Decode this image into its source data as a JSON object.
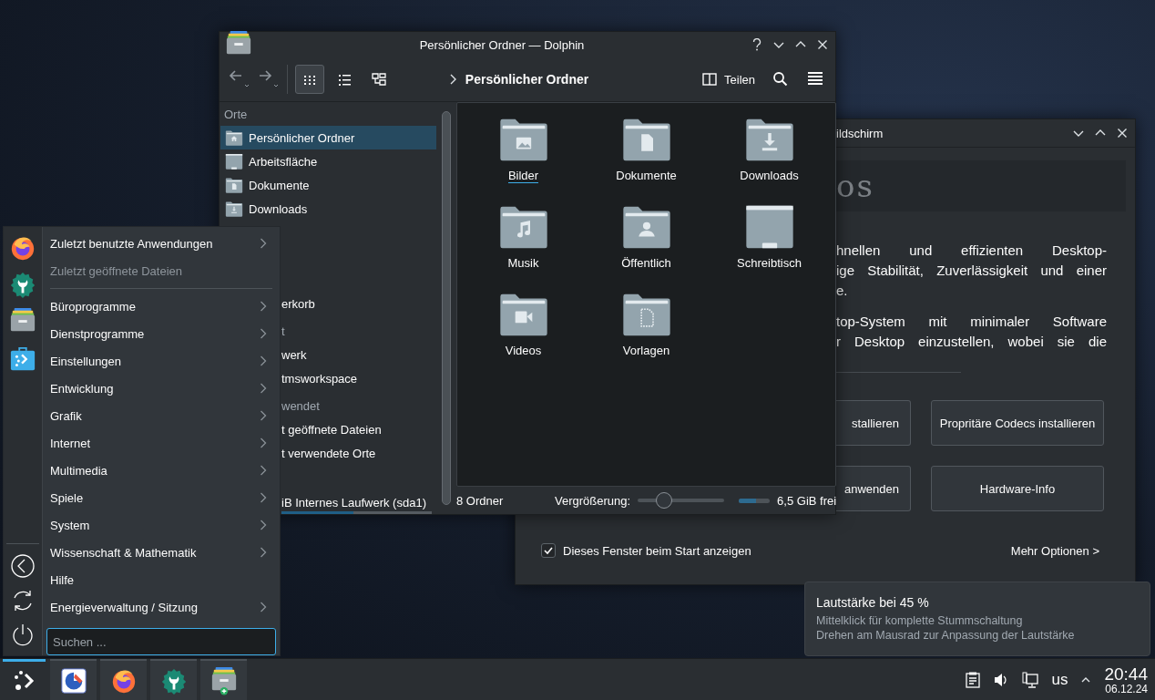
{
  "dolphin": {
    "title": "Persönlicher Ordner — Dolphin",
    "view_modes": [
      {
        "selected": true
      },
      {
        "selected": false
      },
      {
        "selected": false
      }
    ],
    "breadcrumb": "Persönlicher Ordner",
    "split_label": "Teilen",
    "sidebar": {
      "heading": "Orte",
      "items": [
        {
          "label": "Persönlicher Ordner",
          "selected": true
        },
        {
          "label": "Arbeitsfläche",
          "selected": false
        },
        {
          "label": "Dokumente",
          "selected": false
        },
        {
          "label": "Downloads",
          "selected": false
        }
      ],
      "covered_items": [
        {
          "kind": "item",
          "label": "erkorb"
        },
        {
          "kind": "heading",
          "label": "t"
        },
        {
          "kind": "item",
          "label": "werk"
        },
        {
          "kind": "item",
          "label": "tmsworkspace"
        },
        {
          "kind": "heading",
          "label": "wendet"
        },
        {
          "kind": "item",
          "label": "t geöffnete Dateien"
        },
        {
          "kind": "item",
          "label": "t verwendete Orte"
        },
        {
          "kind": "drive",
          "label": "iB Internes Laufwerk (sda1)",
          "level": 0.48
        }
      ]
    },
    "folders": [
      {
        "label": "Bilder",
        "kind": "image",
        "current": true
      },
      {
        "label": "Dokumente",
        "kind": "document",
        "current": false
      },
      {
        "label": "Downloads",
        "kind": "download",
        "current": false
      },
      {
        "label": "Musik",
        "kind": "music",
        "current": false
      },
      {
        "label": "Öffentlich",
        "kind": "user",
        "current": false
      },
      {
        "label": "Schreibtisch",
        "kind": "desktop",
        "current": false
      },
      {
        "label": "Videos",
        "kind": "video",
        "current": false
      },
      {
        "label": "Vorlagen",
        "kind": "template",
        "current": false
      }
    ],
    "status": {
      "count": "8 Ordner",
      "zoom_label": "Vergrößerung:",
      "zoom": {
        "level": 0.3
      },
      "free_space": {
        "level": 0.55
      },
      "free_label": "6,5 GiB frei"
    }
  },
  "welcome": {
    "title": "ildschirm",
    "logo": "os",
    "paragraphs": [
      [
        "hnellen und effizienten Desktop-",
        "ige Stabilität, Zuverlässigkeit und einer",
        "e."
      ],
      [
        "top-System mit minimaler Software",
        "r Desktop einzustellen, wobei sie die"
      ]
    ],
    "buttons": [
      "stallieren",
      "Propritäre Codecs installieren",
      "anwenden",
      "Hardware-Info"
    ],
    "show_on_start": {
      "label": "Dieses Fenster beim Start anzeigen",
      "checked": true
    },
    "more_link": "Mehr Optionen >"
  },
  "app_menu": {
    "items": [
      {
        "kind": "entry",
        "label": "Zuletzt benutzte Anwendungen",
        "submenu": true,
        "disabled": false
      },
      {
        "kind": "entry",
        "label": "Zuletzt geöffnete Dateien",
        "submenu": false,
        "disabled": true
      },
      {
        "kind": "separator"
      },
      {
        "kind": "entry",
        "label": "Büroprogramme",
        "submenu": true,
        "disabled": false
      },
      {
        "kind": "entry",
        "label": "Dienstprogramme",
        "submenu": true,
        "disabled": false
      },
      {
        "kind": "entry",
        "label": "Einstellungen",
        "submenu": true,
        "disabled": false
      },
      {
        "kind": "entry",
        "label": "Entwicklung",
        "submenu": true,
        "disabled": false
      },
      {
        "kind": "entry",
        "label": "Grafik",
        "submenu": true,
        "disabled": false
      },
      {
        "kind": "entry",
        "label": "Internet",
        "submenu": true,
        "disabled": false
      },
      {
        "kind": "entry",
        "label": "Multimedia",
        "submenu": true,
        "disabled": false
      },
      {
        "kind": "entry",
        "label": "Spiele",
        "submenu": true,
        "disabled": false
      },
      {
        "kind": "entry",
        "label": "System",
        "submenu": true,
        "disabled": false
      },
      {
        "kind": "entry",
        "label": "Wissenschaft & Mathematik",
        "submenu": true,
        "disabled": false
      },
      {
        "kind": "entry",
        "label": "Hilfe",
        "submenu": false,
        "disabled": false
      },
      {
        "kind": "entry",
        "label": "Energieverwaltung / Sitzung",
        "submenu": true,
        "disabled": false
      }
    ],
    "search_placeholder": "Suchen ..."
  },
  "tooltip": {
    "title": "Lautstärke bei 45 %",
    "lines": [
      "Mittelklick für komplette Stummschaltung",
      "Drehen am Mausrad zur Anpassung der Lautstärke"
    ]
  },
  "taskbar": {
    "launcher": {
      "active": true
    },
    "tray": {
      "keyboard_layout": "us",
      "time": "20:44",
      "date": "06.12.24"
    }
  }
}
